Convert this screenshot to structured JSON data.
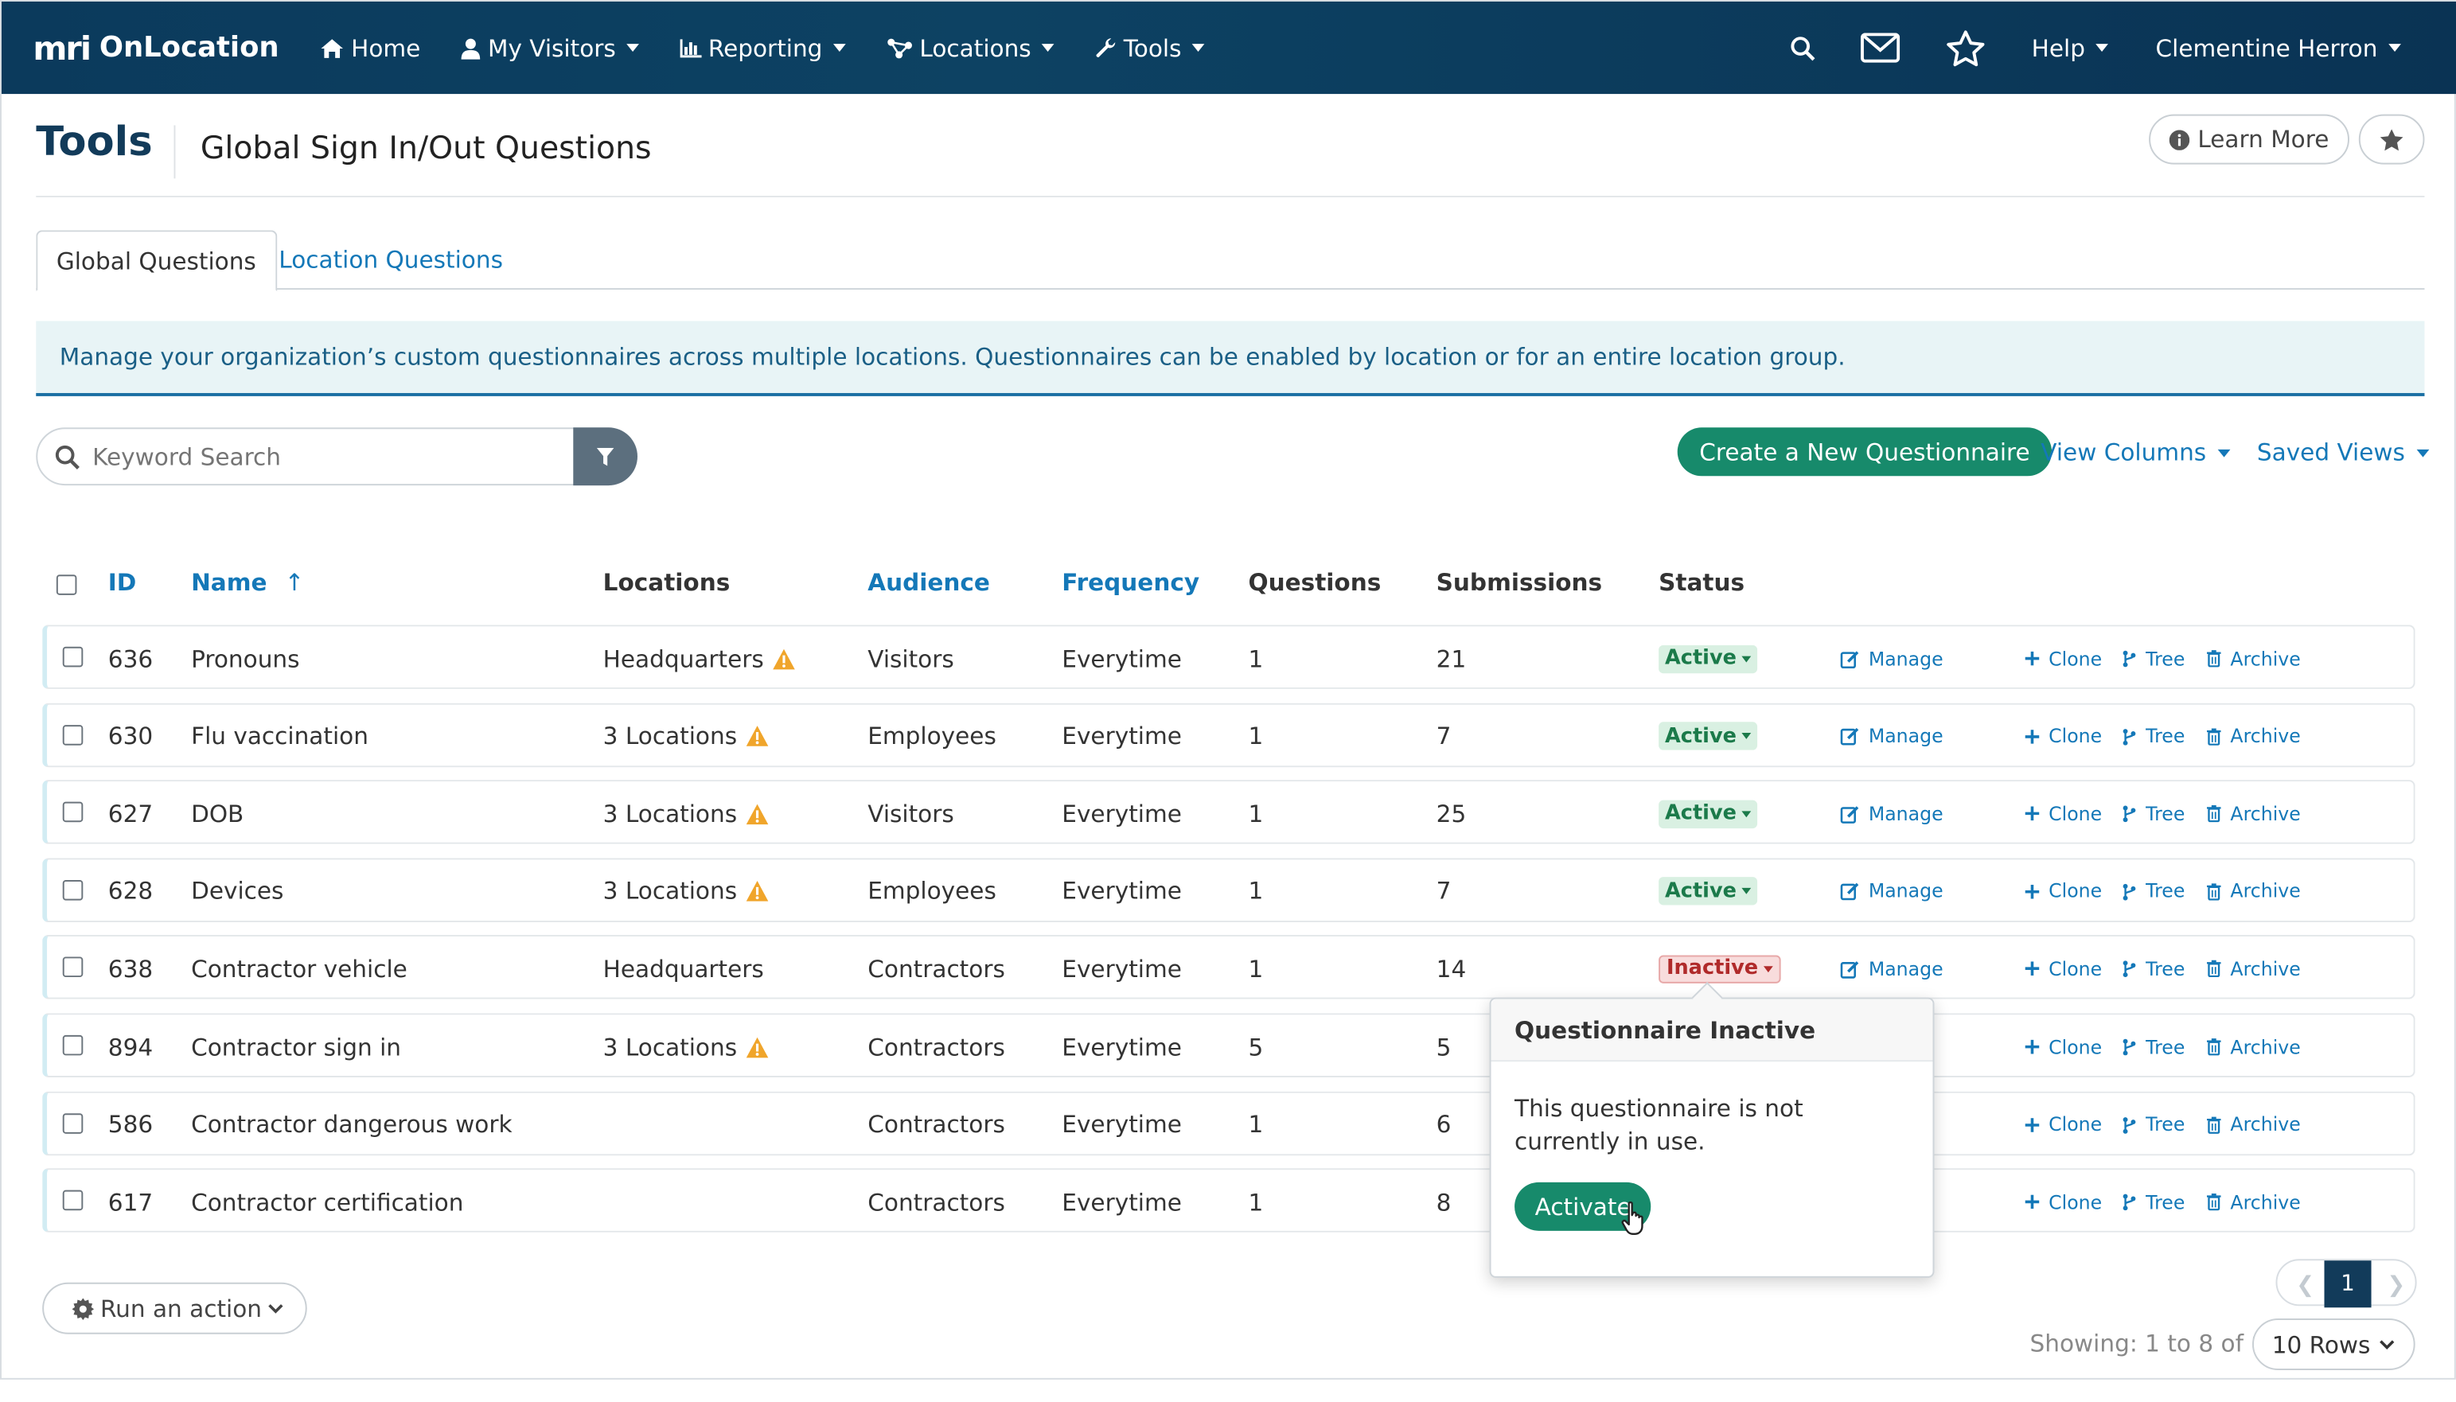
{
  "nav": {
    "logo_text": "mri",
    "app_name": "OnLocation",
    "items": [
      {
        "label": "Home",
        "icon": "home-icon"
      },
      {
        "label": "My Visitors",
        "icon": "user-icon"
      },
      {
        "label": "Reporting",
        "icon": "bar-chart-icon"
      },
      {
        "label": "Locations",
        "icon": "network-icon"
      },
      {
        "label": "Tools",
        "icon": "wrench-icon"
      }
    ],
    "help_label": "Help",
    "user_name": "Clementine Herron"
  },
  "header": {
    "section": "Tools",
    "title": "Global Sign In/Out Questions",
    "learn_more": "Learn More"
  },
  "tabs": [
    {
      "label": "Global Questions",
      "active": true
    },
    {
      "label": "Location Questions",
      "active": false
    }
  ],
  "info_text": "Manage your organization’s custom questionnaires across multiple locations. Questionnaires can be enabled by location or for an entire location group.",
  "search": {
    "placeholder": "Keyword Search"
  },
  "toolbar": {
    "create_label": "Create a New Questionnaire",
    "view_columns": "View Columns",
    "saved_views": "Saved Views"
  },
  "table": {
    "headers": {
      "id": "ID",
      "name": "Name",
      "name_sort_icon": "↑",
      "locations": "Locations",
      "audience": "Audience",
      "frequency": "Frequency",
      "questions": "Questions",
      "submissions": "Submissions",
      "status": "Status"
    },
    "actions": {
      "manage": "Manage",
      "clone": "Clone",
      "tree": "Tree",
      "archive": "Archive"
    },
    "rows": [
      {
        "id": "636",
        "name": "Pronouns",
        "locations": "Headquarters",
        "warn": true,
        "audience": "Visitors",
        "frequency": "Everytime",
        "questions": "1",
        "submissions": "21",
        "status": "Active"
      },
      {
        "id": "630",
        "name": "Flu vaccination",
        "locations": "3 Locations",
        "warn": true,
        "audience": "Employees",
        "frequency": "Everytime",
        "questions": "1",
        "submissions": "7",
        "status": "Active"
      },
      {
        "id": "627",
        "name": "DOB",
        "locations": "3 Locations",
        "warn": true,
        "audience": "Visitors",
        "frequency": "Everytime",
        "questions": "1",
        "submissions": "25",
        "status": "Active"
      },
      {
        "id": "628",
        "name": "Devices",
        "locations": "3 Locations",
        "warn": true,
        "audience": "Employees",
        "frequency": "Everytime",
        "questions": "1",
        "submissions": "7",
        "status": "Active"
      },
      {
        "id": "638",
        "name": "Contractor vehicle",
        "locations": "Headquarters",
        "warn": false,
        "audience": "Contractors",
        "frequency": "Everytime",
        "questions": "1",
        "submissions": "14",
        "status": "Inactive"
      },
      {
        "id": "894",
        "name": "Contractor sign in",
        "locations": "3 Locations",
        "warn": true,
        "audience": "Contractors",
        "frequency": "Everytime",
        "questions": "5",
        "submissions": "5",
        "status": ""
      },
      {
        "id": "586",
        "name": "Contractor dangerous work",
        "locations": "",
        "warn": false,
        "audience": "Contractors",
        "frequency": "Everytime",
        "questions": "1",
        "submissions": "6",
        "status": ""
      },
      {
        "id": "617",
        "name": "Contractor certification",
        "locations": "",
        "warn": false,
        "audience": "Contractors",
        "frequency": "Everytime",
        "questions": "1",
        "submissions": "8",
        "status": ""
      }
    ]
  },
  "popover": {
    "title": "Questionnaire Inactive",
    "body": "This questionnaire is not currently in use.",
    "button": "Activate"
  },
  "footer": {
    "run_action": "Run an action",
    "current_page": "1",
    "showing": "Showing: 1 to 8 of 8",
    "rows_label": "10 Rows"
  },
  "colors": {
    "nav_bg": "#0b3a5c",
    "accent_green": "#178a6b",
    "link_blue": "#1478b8",
    "warning": "#f0a52b"
  }
}
